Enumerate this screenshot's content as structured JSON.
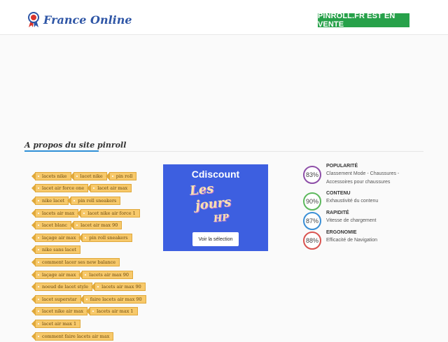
{
  "header": {
    "logo_text": "France Online",
    "sale_button": "PINROLL.FR EST EN VENTE"
  },
  "section": {
    "title": "A propos du site pinroll"
  },
  "tags": [
    [
      "lacets nike",
      "lacet nike",
      "pin roll"
    ],
    [
      "lacet air force one",
      "lacet air max"
    ],
    [
      "nike lacet",
      "pin roll sneakers"
    ],
    [
      "lacets air max",
      "lacet nike air force 1"
    ],
    [
      "lacet blanc",
      "lacet air max 90"
    ],
    [
      "laçage air max",
      "pin roll sneakers"
    ],
    [
      "nike sans lacet"
    ],
    [
      "comment lacer ses new balance"
    ],
    [
      "laçage air max",
      "lacets air max 90"
    ],
    [
      "noeud de lacet style",
      "lacets air max 90"
    ],
    [
      "lacet superstar",
      "faire lacets air max 90"
    ],
    [
      "lacet nike air max",
      "lacets air max 1"
    ],
    [
      "lacet air max 1"
    ],
    [
      "comment faire lacets air max"
    ]
  ],
  "ad": {
    "brand": "Cdiscount",
    "line1": "Les",
    "line2": "jours",
    "line3": "HP",
    "button": "Voir la sélection",
    "bg_color": "#3d5fe0"
  },
  "stats": [
    {
      "value": "83%",
      "percent": 83,
      "title": "POPULARITÉ",
      "desc": "Classement Mode - Chaussures - Accessoires pour chaussures",
      "color": "#8e4fa8"
    },
    {
      "value": "90%",
      "percent": 90,
      "title": "CONTENU",
      "desc": "Exhaustivité du contenu",
      "color": "#5cb85c"
    },
    {
      "value": "87%",
      "percent": 87,
      "title": "RAPIDITÉ",
      "desc": "Vitesse de chargement",
      "color": "#3a8fd6"
    },
    {
      "value": "88%",
      "percent": 88,
      "title": "ERGONOMIE",
      "desc": "Efficacité de Navigation",
      "color": "#d9534f"
    }
  ]
}
